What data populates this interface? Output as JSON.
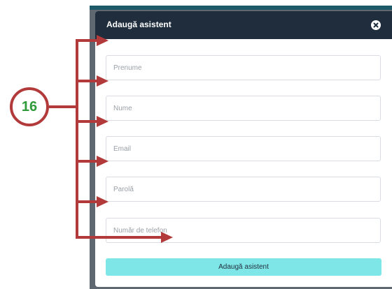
{
  "modal": {
    "title": "Adaugă asistent",
    "fields": [
      {
        "placeholder": "Prenume"
      },
      {
        "placeholder": "Nume"
      },
      {
        "placeholder": "Email"
      },
      {
        "placeholder": "Parolă"
      },
      {
        "placeholder": "Număr de telefon"
      }
    ],
    "submit_label": "Adaugă asistent"
  },
  "annotation": {
    "badge_number": "16"
  },
  "colors": {
    "header": "#1f2d3d",
    "submit": "#7ee6e6",
    "annotation": "#b23a3a",
    "badge_text": "#2e9a3a"
  }
}
